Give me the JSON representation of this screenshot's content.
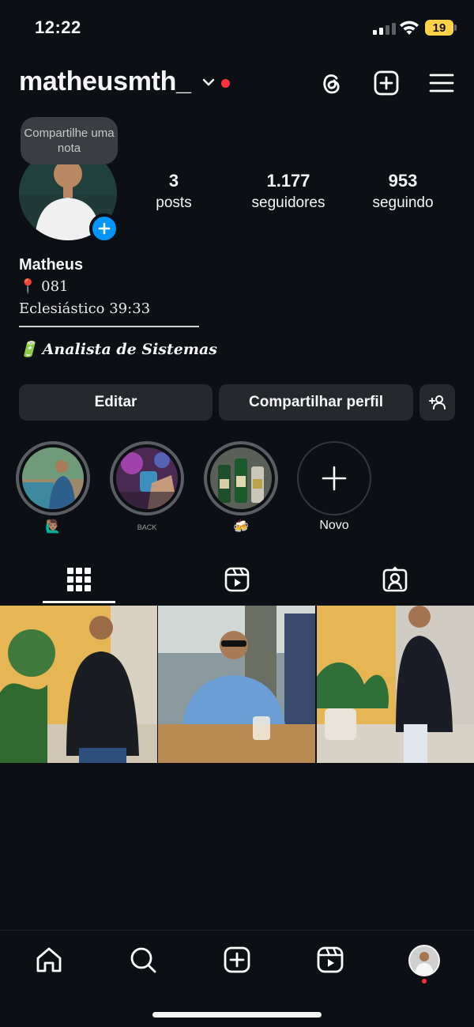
{
  "status_bar": {
    "time": "12:22",
    "battery": "19",
    "icons": [
      "signal-icon",
      "wifi-icon",
      "battery-icon"
    ]
  },
  "header": {
    "username": "matheusmth_",
    "icons": [
      "chevron-down-icon",
      "threads-icon",
      "create-icon",
      "menu-icon"
    ]
  },
  "profile": {
    "note_placeholder": "Compartilhe uma nota",
    "stats": [
      {
        "value": "3",
        "label": "posts"
      },
      {
        "value": "1.177",
        "label": "seguidores"
      },
      {
        "value": "953",
        "label": "seguindo"
      }
    ],
    "name": "Matheus",
    "bio": {
      "location": "081",
      "location_emoji": "📍",
      "verse": "Eclesiástico 39:33",
      "job": "Analista de Sistemas",
      "job_emoji": "🔋"
    }
  },
  "buttons": {
    "edit": "Editar",
    "share": "Compartilhar perfil"
  },
  "highlights": [
    {
      "label": "🙋🏽‍♂️"
    },
    {
      "label": "BACK"
    },
    {
      "label": "🍻"
    },
    {
      "label": "Novo"
    }
  ],
  "tabs": [
    "grid-icon",
    "reels-icon",
    "tagged-icon"
  ],
  "colors": {
    "background": "#0c1014",
    "button": "#25292e",
    "accent": "#0095f6",
    "notification": "#ff3040"
  },
  "bottom_nav": [
    "home-icon",
    "search-icon",
    "create-icon",
    "reels-icon",
    "profile-avatar"
  ]
}
